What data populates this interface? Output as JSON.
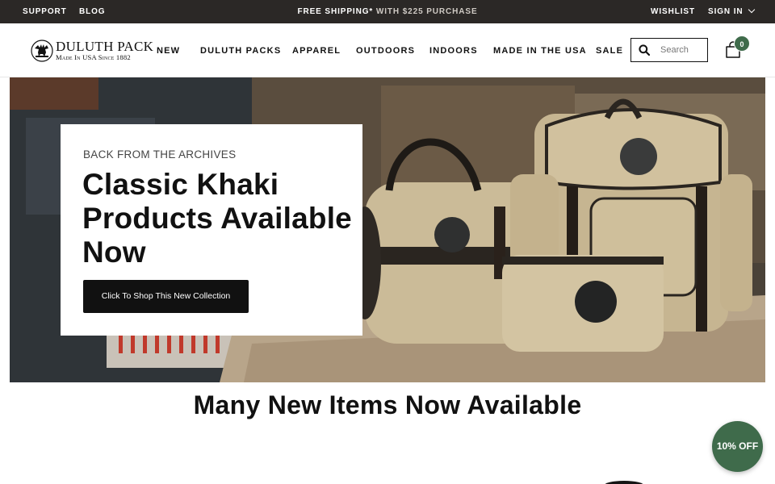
{
  "topbar": {
    "support": "SUPPORT",
    "blog": "BLOG",
    "shipping_bold": "FREE SHIPPING*",
    "shipping_rest": "WITH $225 PURCHASE",
    "wishlist": "WISHLIST",
    "sign_in": "SIGN IN"
  },
  "header": {
    "logo_name": "Duluth Pack",
    "logo_tagline": "Made In USA Since 1882",
    "nav": [
      "NEW",
      "DULUTH PACKS",
      "APPAREL",
      "OUTDOORS",
      "INDOORS",
      "MADE IN THE USA",
      "SALE"
    ],
    "search_placeholder": "Search",
    "cart_count": "0"
  },
  "hero": {
    "eyebrow": "BACK FROM THE ARCHIVES",
    "title": "Classic Khaki Products Available Now",
    "button": "Click To Shop This New Collection"
  },
  "section": {
    "title": "Many New Items Now Available"
  },
  "promo": {
    "label": "10% OFF"
  },
  "colors": {
    "topbar": "#2b2826",
    "accent_green": "#3f6b4b",
    "button": "#111111",
    "khaki": "#c8b894"
  }
}
